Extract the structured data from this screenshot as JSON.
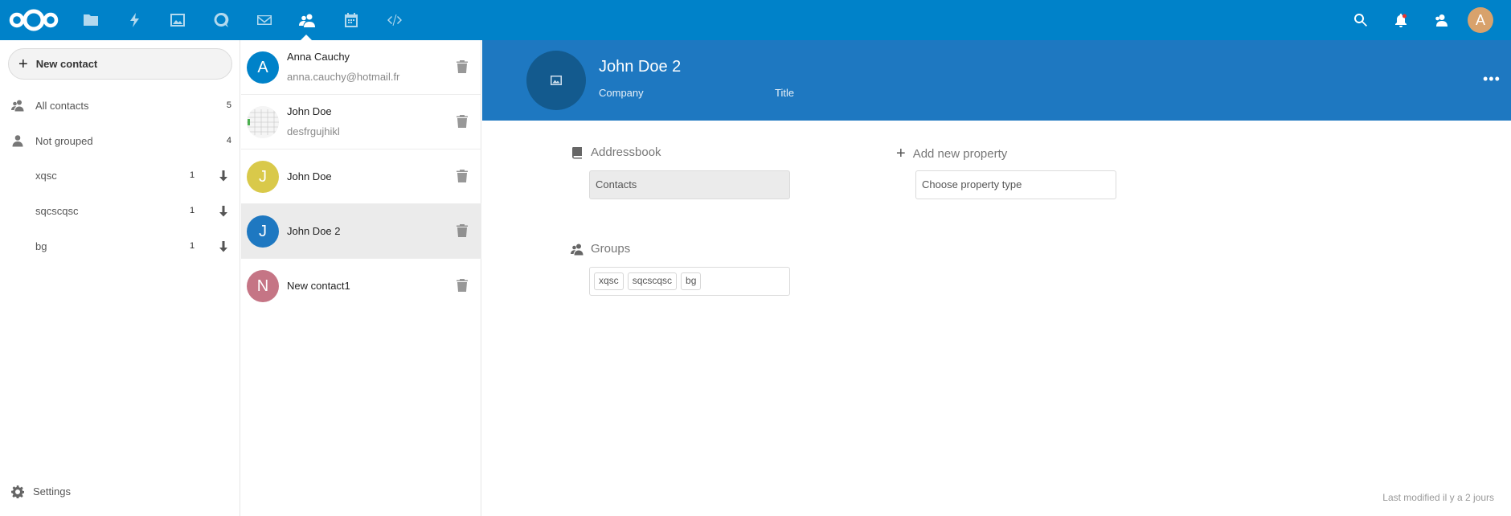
{
  "header": {
    "apps": [
      {
        "name": "Files",
        "icon": "folder-icon"
      },
      {
        "name": "Activity",
        "icon": "lightning-icon"
      },
      {
        "name": "Gallery",
        "icon": "image-icon"
      },
      {
        "name": "Talk",
        "icon": "search-bubble-icon"
      },
      {
        "name": "Mail",
        "icon": "mail-icon"
      },
      {
        "name": "Contacts",
        "icon": "contacts-icon",
        "active": true
      },
      {
        "name": "Calendar",
        "icon": "calendar-icon"
      },
      {
        "name": "Developer",
        "icon": "code-icon"
      }
    ],
    "user_initial": "A",
    "accent_color": "#0082c9"
  },
  "navigation": {
    "new_contact_label": "New contact",
    "all_contacts": {
      "label": "All contacts",
      "count": "5"
    },
    "not_grouped": {
      "label": "Not grouped",
      "count": "4"
    },
    "groups": [
      {
        "label": "xqsc",
        "count": "1"
      },
      {
        "label": "sqcscqsc",
        "count": "1"
      },
      {
        "label": "bg",
        "count": "1"
      }
    ],
    "settings_label": "Settings"
  },
  "contacts": [
    {
      "initial": "A",
      "name": "Anna Cauchy",
      "sub": "anna.cauchy@hotmail.fr",
      "color": "#0082c9"
    },
    {
      "initial": "",
      "name": "John Doe",
      "sub": "desfrgujhikl",
      "color": "#f4f4f4"
    },
    {
      "initial": "J",
      "name": "John Doe",
      "sub": "",
      "color": "#d9c94a"
    },
    {
      "initial": "J",
      "name": "John Doe 2",
      "sub": "",
      "color": "#1e78c1",
      "selected": true
    },
    {
      "initial": "N",
      "name": "New contact1",
      "sub": "",
      "color": "#c57585"
    }
  ],
  "details": {
    "name": "John Doe 2",
    "company_placeholder": "Company",
    "title_placeholder": "Title",
    "addressbook_label": "Addressbook",
    "addressbook_value": "Contacts",
    "add_property_label": "Add new property",
    "property_type_placeholder": "Choose property type",
    "groups_label": "Groups",
    "group_tags": [
      "xqsc",
      "sqcscqsc",
      "bg"
    ],
    "last_modified": "Last modified il y a 2 jours",
    "header_color": "#1e78c1"
  }
}
